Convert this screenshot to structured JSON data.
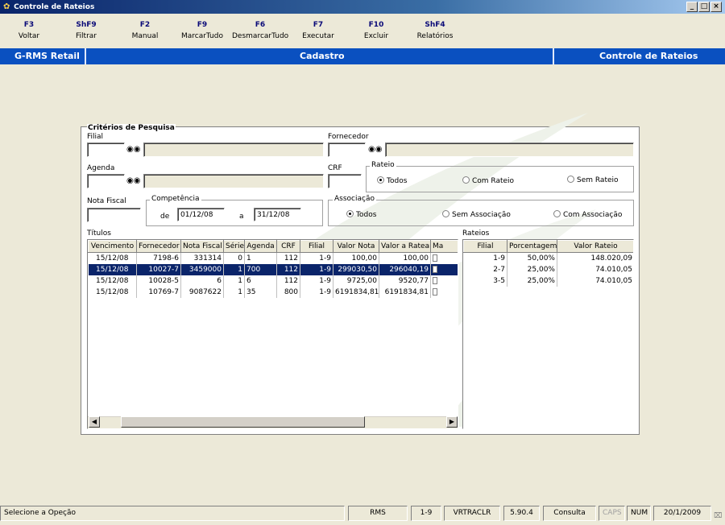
{
  "window": {
    "title": "Controle de Rateios"
  },
  "toolbar": [
    {
      "key": "F3",
      "label": "Voltar"
    },
    {
      "key": "ShF9",
      "label": "Filtrar"
    },
    {
      "key": "F2",
      "label": "Manual"
    },
    {
      "key": "F9",
      "label": "MarcarTudo"
    },
    {
      "key": "F6",
      "label": "DesmarcarTudo"
    },
    {
      "key": "F7",
      "label": "Executar"
    },
    {
      "key": "F10",
      "label": "Excluir"
    },
    {
      "key": "ShF4",
      "label": "Relatórios"
    }
  ],
  "band": {
    "left": "G-RMS Retail",
    "center": "Cadastro",
    "right": "Controle de Rateios"
  },
  "criteria": {
    "title": "Critérios de Pesquisa",
    "filial_label": "Filial",
    "fornecedor_label": "Fornecedor",
    "agenda_label": "Agenda",
    "crf_label": "CRF",
    "rateio": {
      "title": "Rateio",
      "options": [
        "Todos",
        "Com Rateio",
        "Sem Rateio"
      ],
      "selected": "Todos"
    },
    "nota_fiscal_label": "Nota Fiscal",
    "competencia": {
      "title": "Competência",
      "de_label": "de",
      "a_label": "a",
      "de_value": "01/12/08",
      "a_value": "31/12/08"
    },
    "associacao": {
      "title": "Associação",
      "options": [
        "Todos",
        "Sem Associação",
        "Com Associação"
      ],
      "selected": "Todos"
    }
  },
  "titulos": {
    "label": "Títulos",
    "columns": [
      "Vencimento",
      "Fornecedor",
      "Nota Fiscal",
      "Série",
      "Agenda",
      "CRF",
      "Filial",
      "Valor Nota",
      "Valor a Ratear",
      "Ma"
    ],
    "rows": [
      [
        "15/12/08",
        "7198-6",
        "331314",
        "0",
        "1",
        "112",
        "1-9",
        "100,00",
        "100,00"
      ],
      [
        "15/12/08",
        "10027-7",
        "3459000",
        "1",
        "700",
        "112",
        "1-9",
        "299030,50",
        "296040,19"
      ],
      [
        "15/12/08",
        "10028-5",
        "6",
        "1",
        "6",
        "112",
        "1-9",
        "9725,00",
        "9520,77"
      ],
      [
        "15/12/08",
        "10769-7",
        "9087622",
        "1",
        "35",
        "800",
        "1-9",
        "6191834,81",
        "6191834,81"
      ]
    ],
    "selected_row": 1
  },
  "rateios": {
    "label": "Rateios",
    "columns": [
      "Filial",
      "Porcentagem",
      "Valor Rateio"
    ],
    "rows": [
      [
        "1-9",
        "50,00%",
        "148.020,09"
      ],
      [
        "2-7",
        "25,00%",
        "74.010,05"
      ],
      [
        "3-5",
        "25,00%",
        "74.010,05"
      ]
    ]
  },
  "statusbar": {
    "message": "Selecione a Opeção",
    "system": "RMS",
    "filial": "1-9",
    "program": "VRTRACLR",
    "version": "5.90.4",
    "mode": "Consulta",
    "caps": "CAPS",
    "num": "NUM",
    "date": "20/1/2009"
  },
  "colors": {
    "band": "#0a50c0",
    "selection": "#0a246a",
    "key_text": "#0a0a78"
  },
  "icons": {
    "find": "binoculars-icon",
    "app": "app-icon"
  }
}
